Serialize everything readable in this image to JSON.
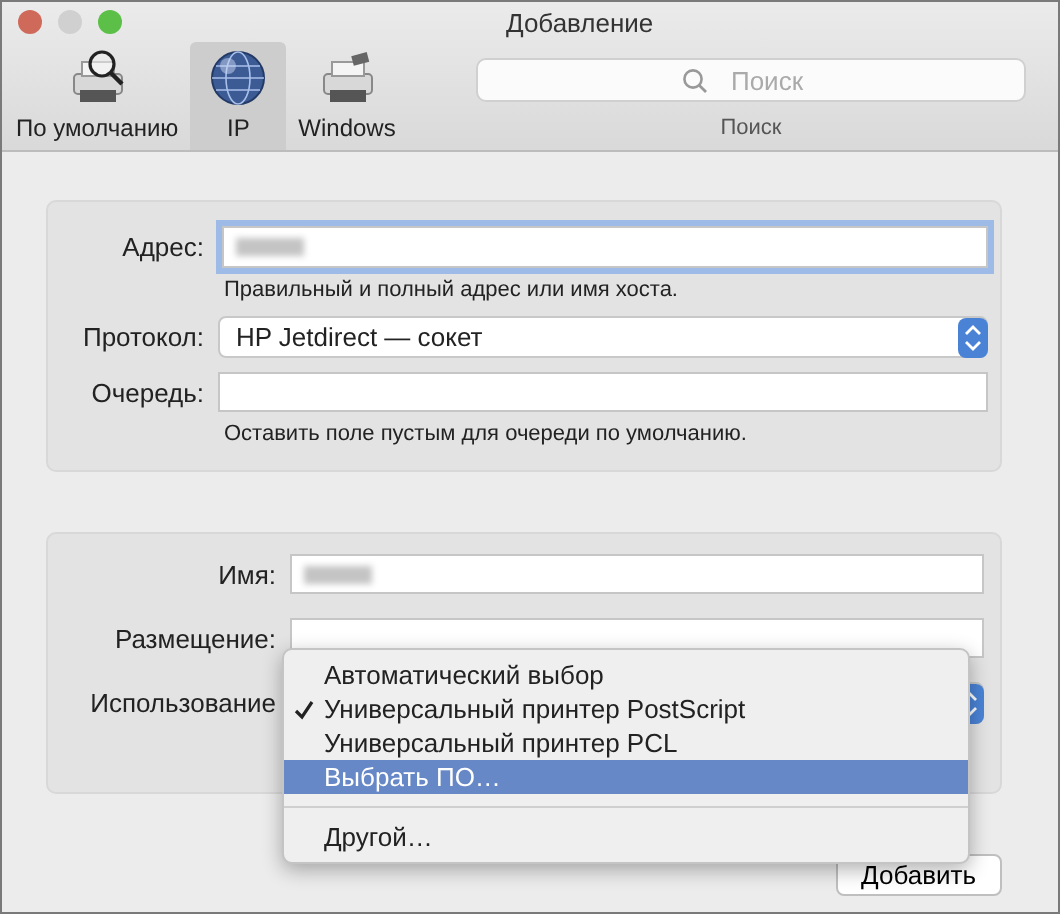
{
  "window": {
    "title": "Добавление"
  },
  "toolbar": {
    "tabs": [
      {
        "label": "По умолчанию",
        "kind": "printer-search",
        "selected": false
      },
      {
        "label": "IP",
        "kind": "globe",
        "selected": true
      },
      {
        "label": "Windows",
        "kind": "printer",
        "selected": false
      }
    ],
    "search": {
      "placeholder": "Поиск",
      "label": "Поиск"
    }
  },
  "connection": {
    "fields": [
      {
        "kind": "text",
        "label": "Адрес:",
        "focused": true,
        "redacted": true,
        "hint": "Правильный и полный адрес или имя хоста."
      },
      {
        "kind": "popup",
        "label": "Протокол:",
        "value": "HP Jetdirect — сокет"
      },
      {
        "kind": "text",
        "label": "Очередь:",
        "hint": "Оставить поле пустым для очереди по умолчанию."
      }
    ]
  },
  "details": {
    "fields": [
      {
        "kind": "text",
        "label": "Имя:",
        "redacted": true
      },
      {
        "kind": "text",
        "label": "Размещение:"
      },
      {
        "kind": "popup",
        "label": "Использование"
      }
    ]
  },
  "menu": {
    "items": [
      {
        "kind": "item",
        "label": "Автоматический выбор",
        "checked": false,
        "selected": false
      },
      {
        "kind": "item",
        "label": "Универсальный принтер PostScript",
        "checked": true,
        "selected": false
      },
      {
        "kind": "item",
        "label": "Универсальный принтер PCL",
        "checked": false,
        "selected": false
      },
      {
        "kind": "item",
        "label": "Выбрать ПО…",
        "checked": false,
        "selected": true
      },
      {
        "kind": "separator"
      },
      {
        "kind": "item",
        "label": "Другой…",
        "checked": false,
        "selected": false
      }
    ]
  },
  "buttons": [
    {
      "label": "Добавить"
    }
  ]
}
